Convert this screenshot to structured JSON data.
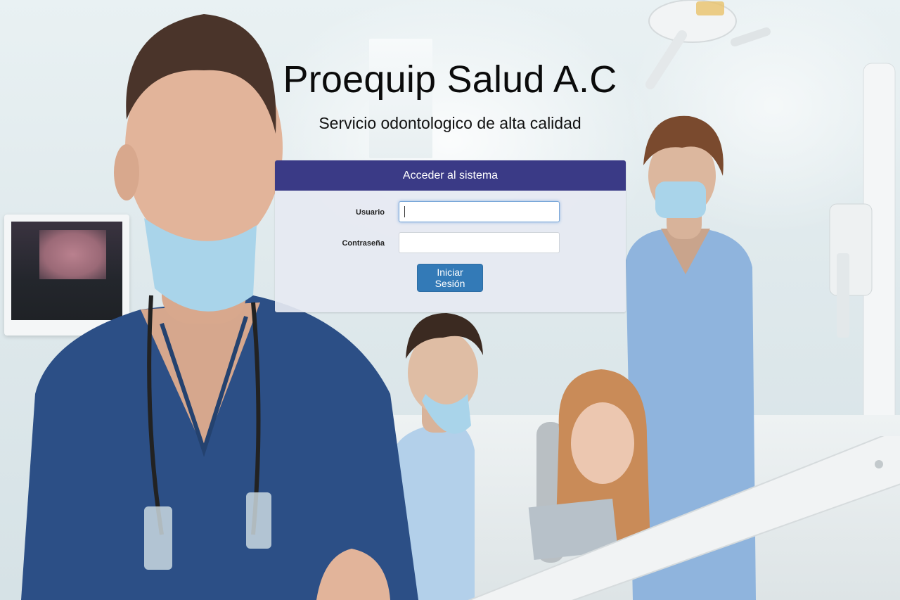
{
  "header": {
    "title": "Proequip Salud A.C",
    "subtitle": "Servicio odontologico de alta calidad"
  },
  "login": {
    "panel_title": "Acceder al sistema",
    "username_label": "Usuario",
    "username_value": "",
    "password_label": "Contraseña",
    "password_value": "",
    "submit_label": "Iniciar Sesión"
  },
  "colors": {
    "panel_header": "#3a3a86",
    "panel_body": "#e6e9f2",
    "button": "#337ab7",
    "scrubs_dark": "#2c4f86",
    "scrubs_light": "#8fb4dd"
  }
}
